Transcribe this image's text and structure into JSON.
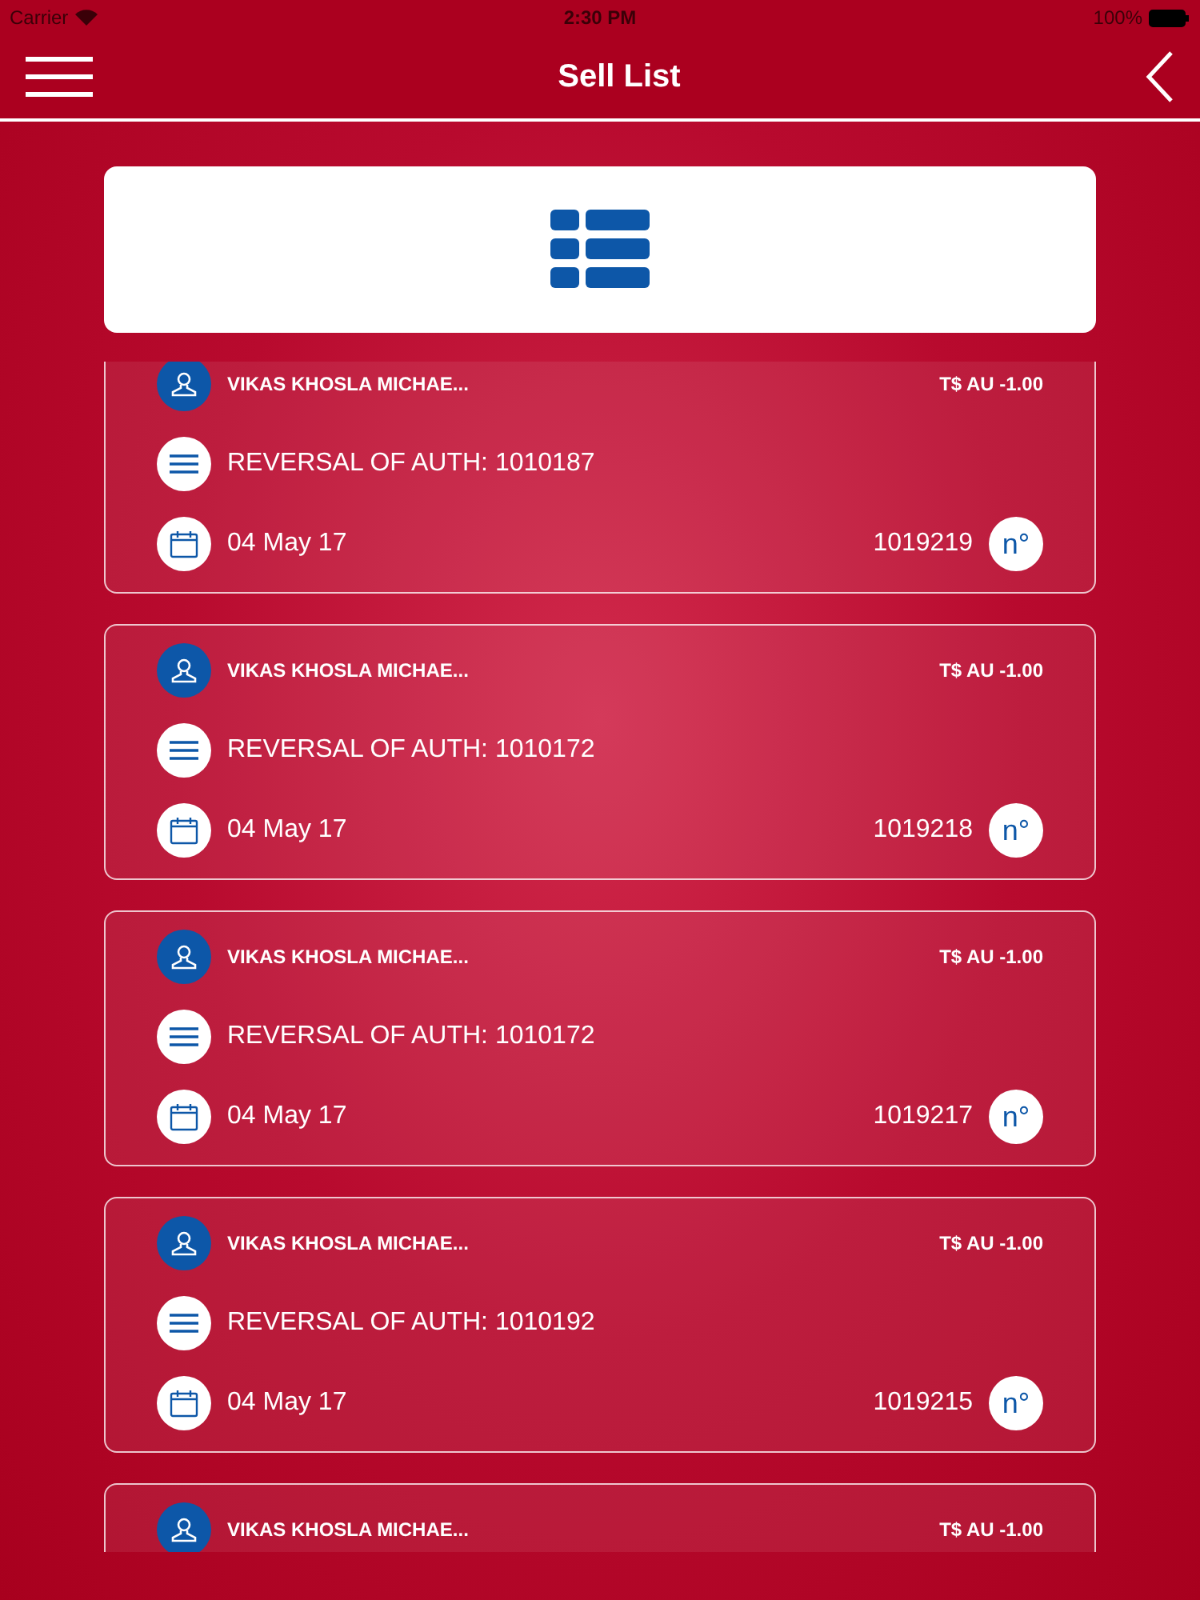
{
  "status_bar": {
    "carrier": "Carrier",
    "time": "2:30 PM",
    "battery": "100%"
  },
  "nav_bar": {
    "title": "Sell List"
  },
  "items": [
    {
      "name": "VIKAS KHOSLA MICHAE...",
      "amount": "T$ AU -1.00",
      "description": "REVERSAL OF AUTH: 1010187",
      "date": "04 May 17",
      "number": "1019219",
      "number_badge": "n°"
    },
    {
      "name": "VIKAS KHOSLA MICHAE...",
      "amount": "T$ AU -1.00",
      "description": "REVERSAL OF AUTH: 1010172",
      "date": "04 May 17",
      "number": "1019218",
      "number_badge": "n°"
    },
    {
      "name": "VIKAS KHOSLA MICHAE...",
      "amount": "T$ AU -1.00",
      "description": "REVERSAL OF AUTH: 1010172",
      "date": "04 May 17",
      "number": "1019217",
      "number_badge": "n°"
    },
    {
      "name": "VIKAS KHOSLA MICHAE...",
      "amount": "T$ AU -1.00",
      "description": "REVERSAL OF AUTH: 1010192",
      "date": "04 May 17",
      "number": "1019215",
      "number_badge": "n°"
    },
    {
      "name": "VIKAS KHOSLA MICHAE...",
      "amount": "T$ AU -1.00"
    }
  ]
}
